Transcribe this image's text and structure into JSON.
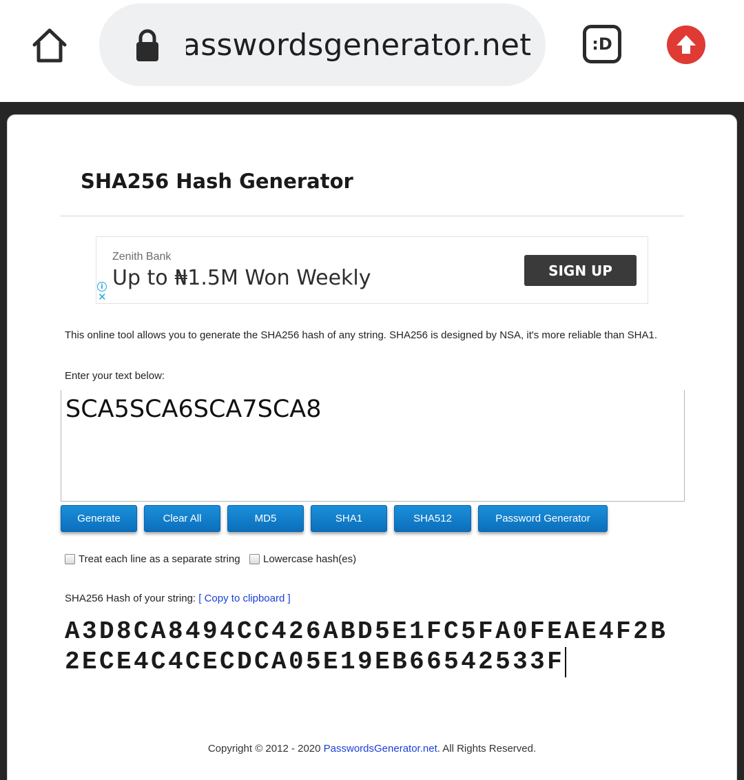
{
  "browser": {
    "url": "passwordsgenerator.net",
    "emoji_label": ":D"
  },
  "page": {
    "title": "SHA256 Hash Generator",
    "description": "This online tool allows you to generate the SHA256 hash of any string. SHA256 is designed by NSA, it's more reliable than SHA1.",
    "enter_label": "Enter your text below:",
    "input_value": "SCA5SCA6SCA7SCA8"
  },
  "ad": {
    "brand": "Zenith Bank",
    "headline": "Up to ₦1.5M Won Weekly",
    "cta": "SIGN UP",
    "info_glyph": "i",
    "close_glyph": "✕"
  },
  "buttons": {
    "generate": "Generate",
    "clear_all": "Clear All",
    "md5": "MD5",
    "sha1": "SHA1",
    "sha512": "SHA512",
    "password_generator": "Password Generator"
  },
  "options": {
    "separate_lines": "Treat each line as a separate string",
    "lowercase": "Lowercase hash(es)"
  },
  "result": {
    "label": "SHA256 Hash of your string:",
    "copy_link": "[ Copy to clipboard ]",
    "hash": "A3D8CA8494CC426ABD5E1FC5FA0FEAE4F2B2ECE4C4CECDCA05E19EB66542533F"
  },
  "footer": {
    "prefix": "Copyright © 2012 - 2020 ",
    "link": "PasswordsGenerator.net",
    "suffix": ". All Rights Reserved."
  },
  "colors": {
    "accent_blue": "#0b7fd0",
    "upload_red": "#e03a34",
    "page_dark": "#262626",
    "link_blue": "#1a3fd8"
  },
  "icons": [
    "home-icon",
    "lock-icon",
    "emoji-icon",
    "upload-icon",
    "info-icon",
    "close-icon",
    "checkbox-icon"
  ]
}
